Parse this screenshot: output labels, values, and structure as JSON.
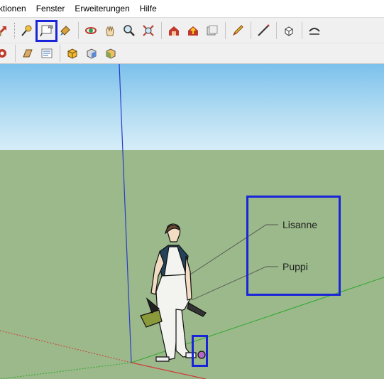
{
  "menubar": {
    "items": [
      "ktionen",
      "Fenster",
      "Erweiterungen",
      "Hilfe"
    ]
  },
  "toolbar1": {
    "icons": [
      "arrow-icon",
      "measure-icon",
      "text-icon",
      "paint-icon",
      "orbit-icon",
      "pan-icon",
      "zoom-icon",
      "zoom-extents-icon",
      "warehouse-icon",
      "share-model-icon",
      "send-to-layout-icon",
      "pencil-icon",
      "line-icon",
      "box-icon",
      "arc-icon"
    ],
    "text_tool_badge": "A1"
  },
  "toolbar2": {
    "icons": [
      "dynamic-component-icon",
      "section-plane-icon",
      "scene-icon",
      "iso-icon",
      "front-view-icon",
      "shaded-icon"
    ]
  },
  "viewport": {
    "labels": {
      "first": "Lisanne",
      "second": "Puppi"
    }
  },
  "colors": {
    "highlight": "#1a24d8",
    "sky": "#8fcaee",
    "ground": "#9bb98a"
  }
}
